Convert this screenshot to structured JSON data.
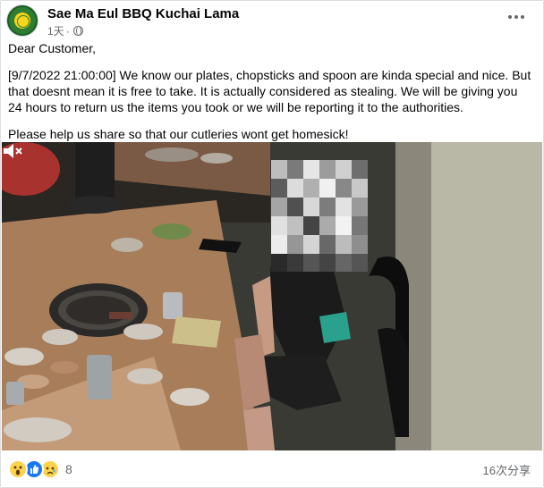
{
  "post": {
    "page_name": "Sae Ma Eul BBQ Kuchai Lama",
    "time_ago": "1天",
    "privacy_icon": "globe-icon",
    "more_icon": "more-horizontal-icon",
    "greeting": "Dear Customer,",
    "body": "[9/7/2022 21:00:00] We know our plates, chopsticks and spoon are kinda special and nice. But that doesnt mean it is free to take. It is actually considered as stealing. We will be giving you 24 hours to return us the items you took or we will be reporting it to the authorities.",
    "closing": "Please help us share so that our cutleries wont get homesick!"
  },
  "video": {
    "volume_icon": "volume-icon"
  },
  "footer": {
    "reaction_icons": [
      "wow-icon",
      "like-icon",
      "sad-icon"
    ],
    "reaction_count": "8",
    "shares": "16次分享"
  },
  "colors": {
    "text": "#050505",
    "secondary": "#65676b",
    "like_blue": "#1877f2",
    "emoji_yellow": "#fcd34d"
  }
}
